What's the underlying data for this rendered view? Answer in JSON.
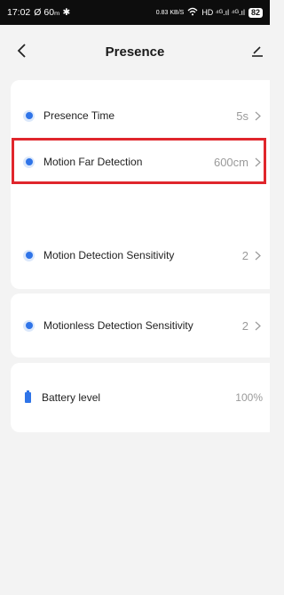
{
  "status_bar": {
    "time": "17:02",
    "left_indicators": "Ø 60ₘ ✱",
    "network_speed": "0.83 KB/S",
    "network_icons": "HD ⁴ᴳ.ıl ⁴ᴳ.ıl",
    "battery_level": "82"
  },
  "header": {
    "title": "Presence"
  },
  "rows": [
    {
      "label": "Presence Time",
      "value": "5s"
    },
    {
      "label": "Motion Far Detection",
      "value": "600cm"
    },
    {
      "label": "Motion Detection Sensitivity",
      "value": "2"
    },
    {
      "label": "Motionless Detection Sensitivity",
      "value": "2"
    }
  ],
  "battery": {
    "label": "Battery level",
    "value": "100%"
  },
  "colors": {
    "accent": "#2f74e8",
    "highlight_border": "#e0262c",
    "value_text": "#9a9a9a",
    "page_background": "#f3f3f3"
  },
  "icons": [
    "back-arrow-icon",
    "edit-pencil-icon",
    "radio-dot-icon",
    "chevron-right-icon",
    "battery-icon"
  ]
}
